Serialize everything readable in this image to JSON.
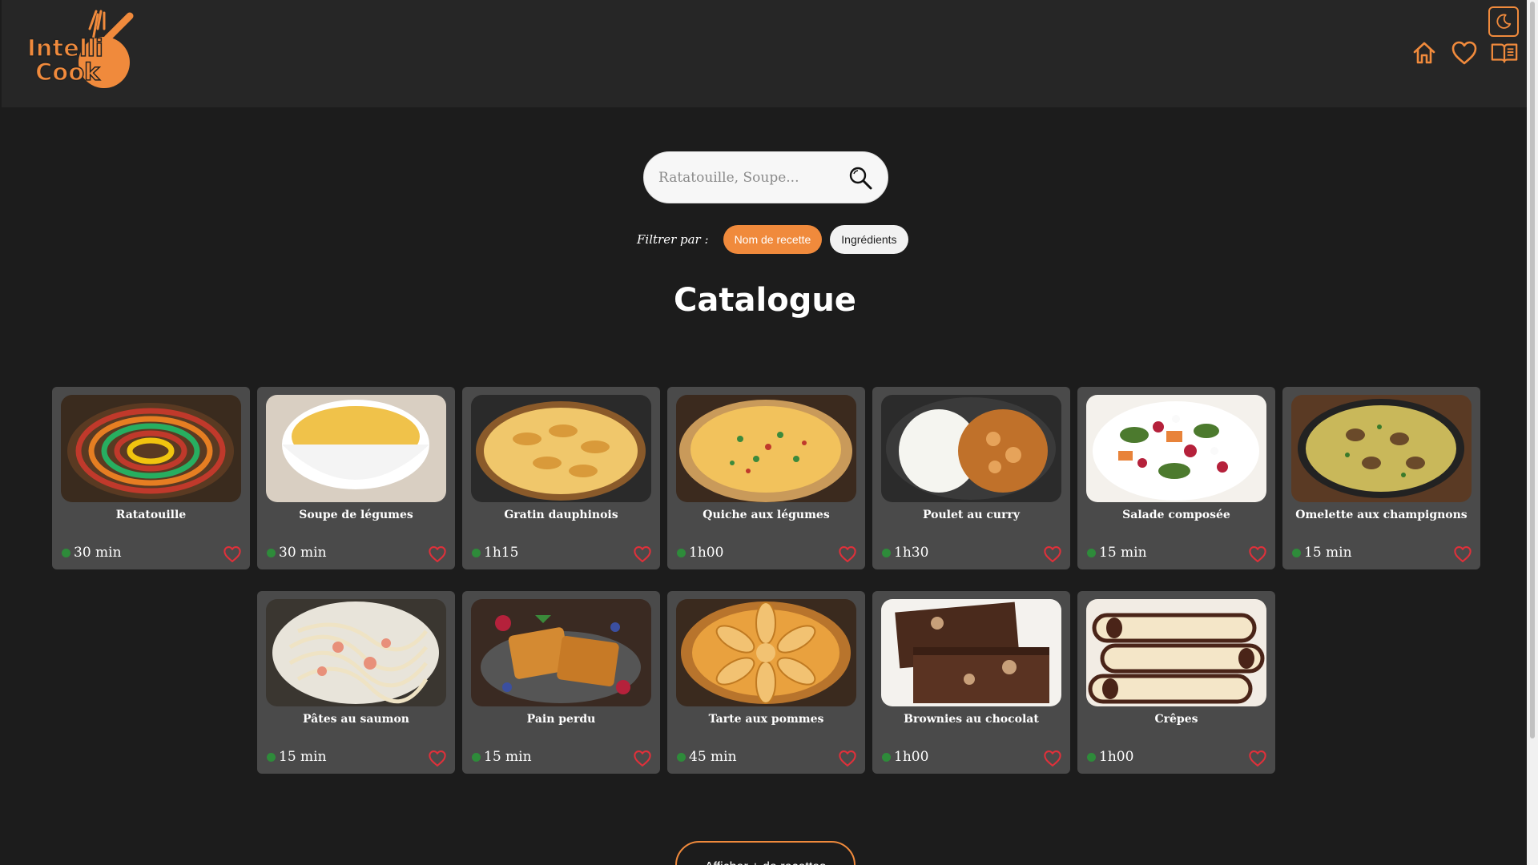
{
  "header": {
    "logo_line1": "Intelli",
    "logo_line2": "Cook",
    "nav": [
      "home-icon",
      "heart-icon",
      "book-icon"
    ],
    "theme_icon": "moon-icon"
  },
  "search": {
    "placeholder": "Ratatouille, Soupe...",
    "value": ""
  },
  "filter": {
    "label": "Filtrer par :",
    "options": [
      "Nom de recette",
      "Ingrédients"
    ],
    "active": "Nom de recette"
  },
  "catalogue": {
    "title": "Catalogue",
    "recipes": [
      {
        "name": "Ratatouille",
        "time": "30 min"
      },
      {
        "name": "Soupe de légumes",
        "time": "30 min"
      },
      {
        "name": "Gratin dauphinois",
        "time": "1h15"
      },
      {
        "name": "Quiche aux légumes",
        "time": "1h00"
      },
      {
        "name": "Poulet au curry",
        "time": "1h30"
      },
      {
        "name": "Salade composée",
        "time": "15 min"
      },
      {
        "name": "Omelette aux champignons",
        "time": "15 min"
      },
      {
        "name": "Pâtes au saumon",
        "time": "15 min"
      },
      {
        "name": "Pain perdu",
        "time": "15 min"
      },
      {
        "name": "Tarte aux pommes",
        "time": "45 min"
      },
      {
        "name": "Brownies au chocolat",
        "time": "1h00"
      },
      {
        "name": "Crêpes",
        "time": "1h00"
      }
    ]
  },
  "more_button": "Afficher + de recettes",
  "colors": {
    "accent": "#f08a3c",
    "background": "#1c1c1c",
    "header": "#262626",
    "card": "#4a4a4a",
    "heart": "#e0303a",
    "time_dot": "#2e8b3a"
  }
}
